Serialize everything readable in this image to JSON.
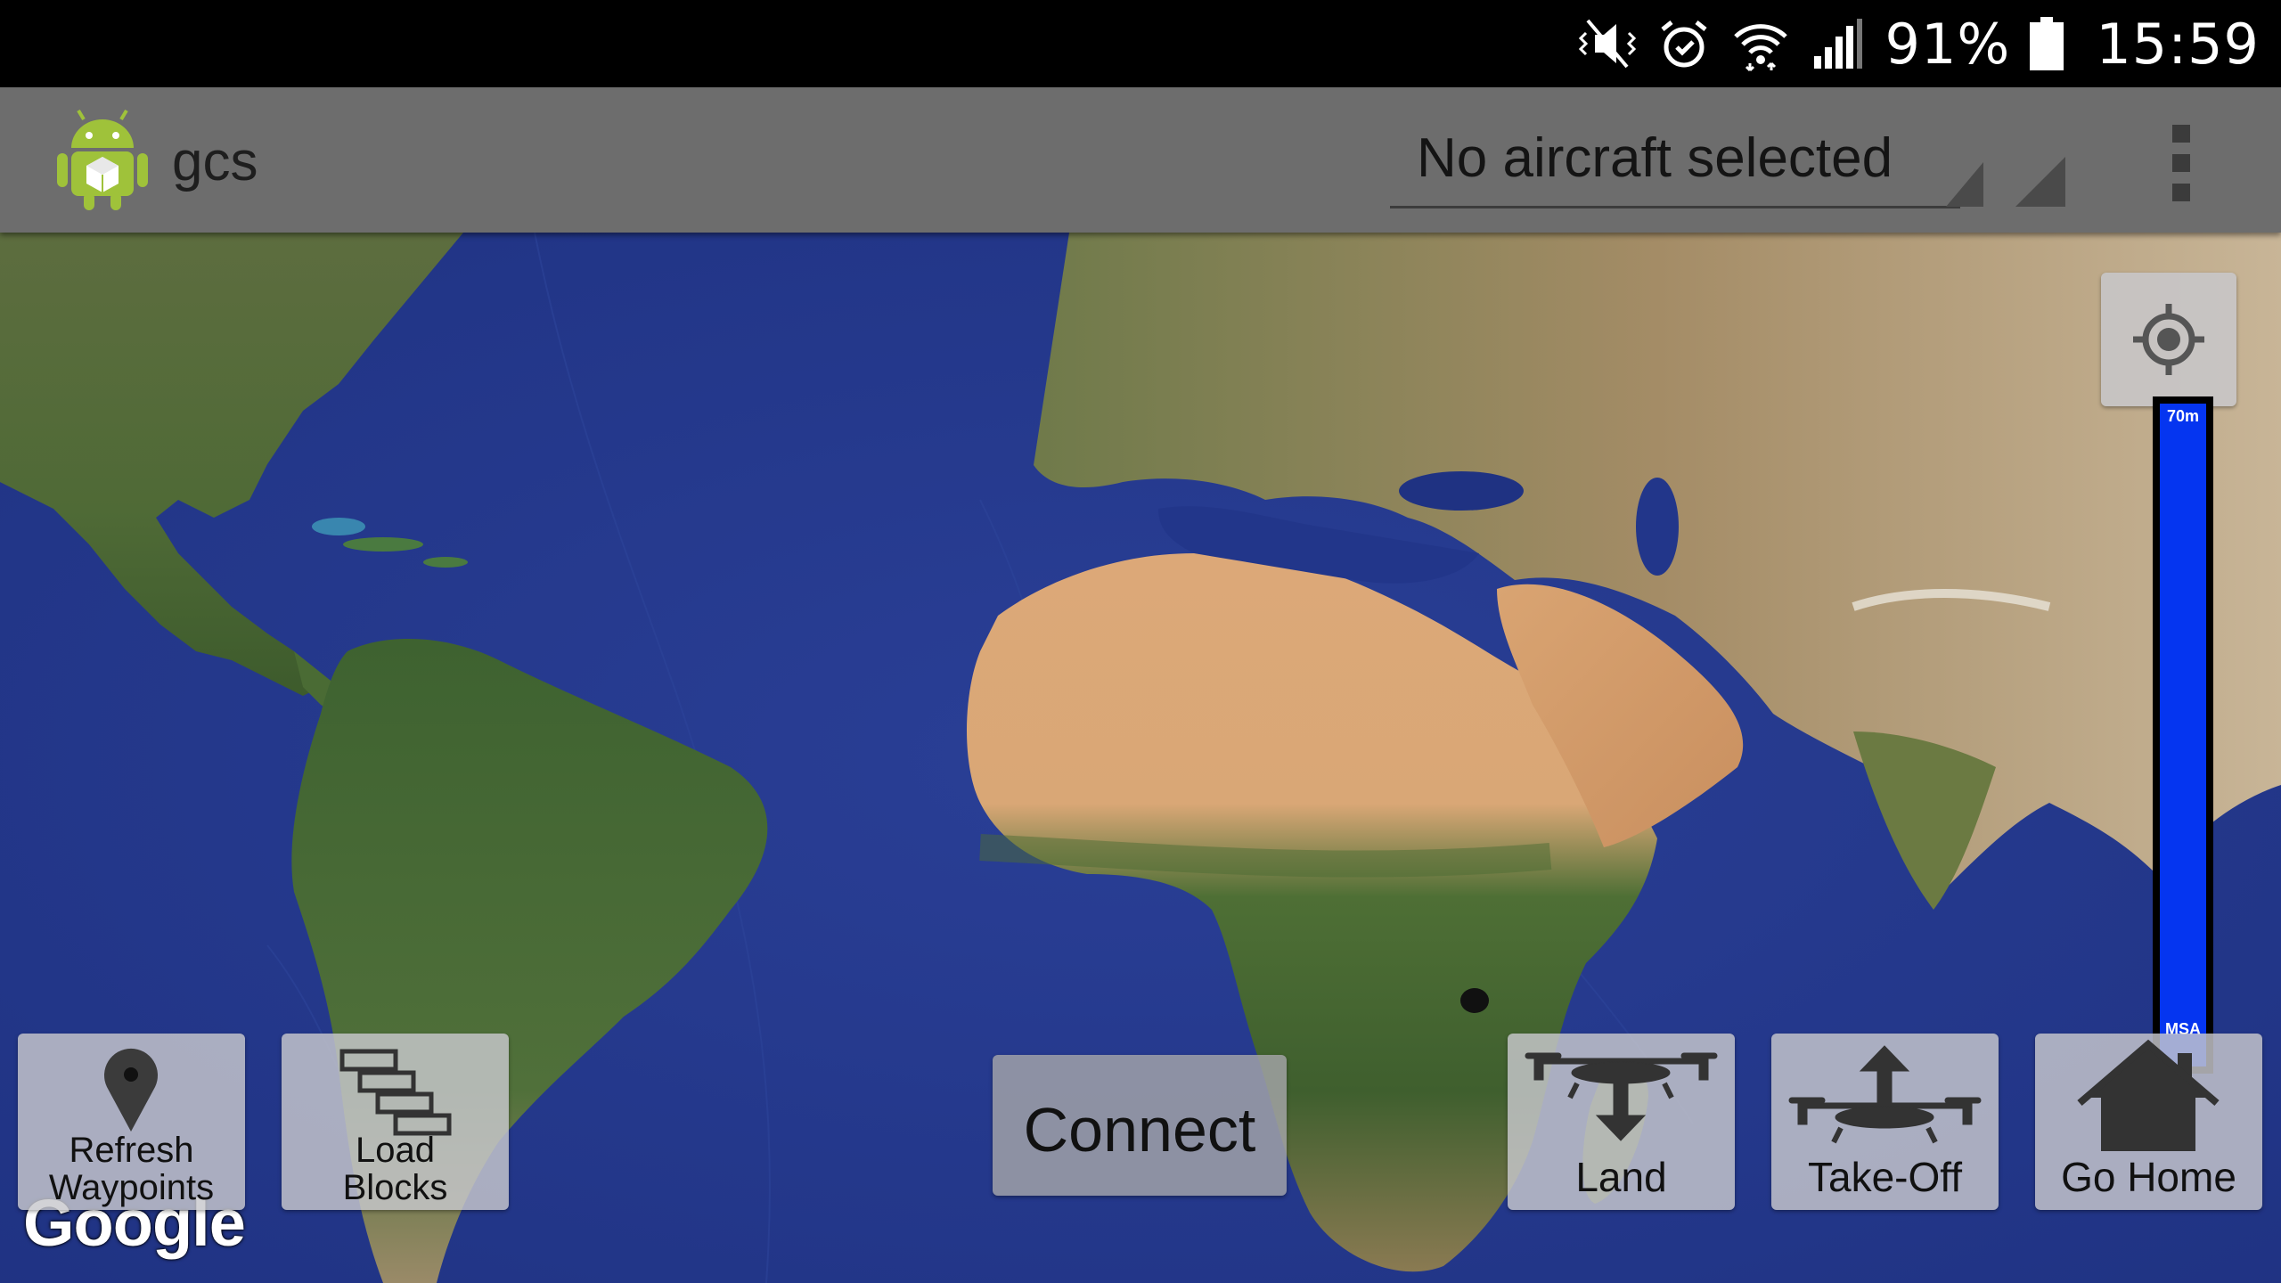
{
  "status_bar": {
    "icons": [
      "mute-vibrate-icon",
      "alarm-icon",
      "wifi-icon",
      "cell-signal-icon",
      "battery-icon"
    ],
    "battery_percent": "91%",
    "time": "15:59"
  },
  "action_bar": {
    "app_title": "gcs",
    "app_icon": "android-robot-icon",
    "aircraft_selector": "No aircraft selected",
    "overflow_icon": "overflow-menu-icon"
  },
  "map": {
    "attribution": "Google",
    "my_location_icon": "crosshair-icon"
  },
  "altitude_bar": {
    "top_label": "70m",
    "bottom_label": "MSA",
    "color": "#0535f0"
  },
  "buttons": {
    "refresh_waypoints": [
      "Refresh",
      "Waypoints"
    ],
    "load_blocks": [
      "Load",
      "Blocks"
    ],
    "connect": "Connect",
    "land": "Land",
    "takeoff": "Take-Off",
    "go_home": "Go Home"
  },
  "colors": {
    "status_bar": "#000000",
    "action_bar": "#6d6d6d",
    "ocean": "#24378a",
    "button_panel": "#c8c8cd"
  }
}
